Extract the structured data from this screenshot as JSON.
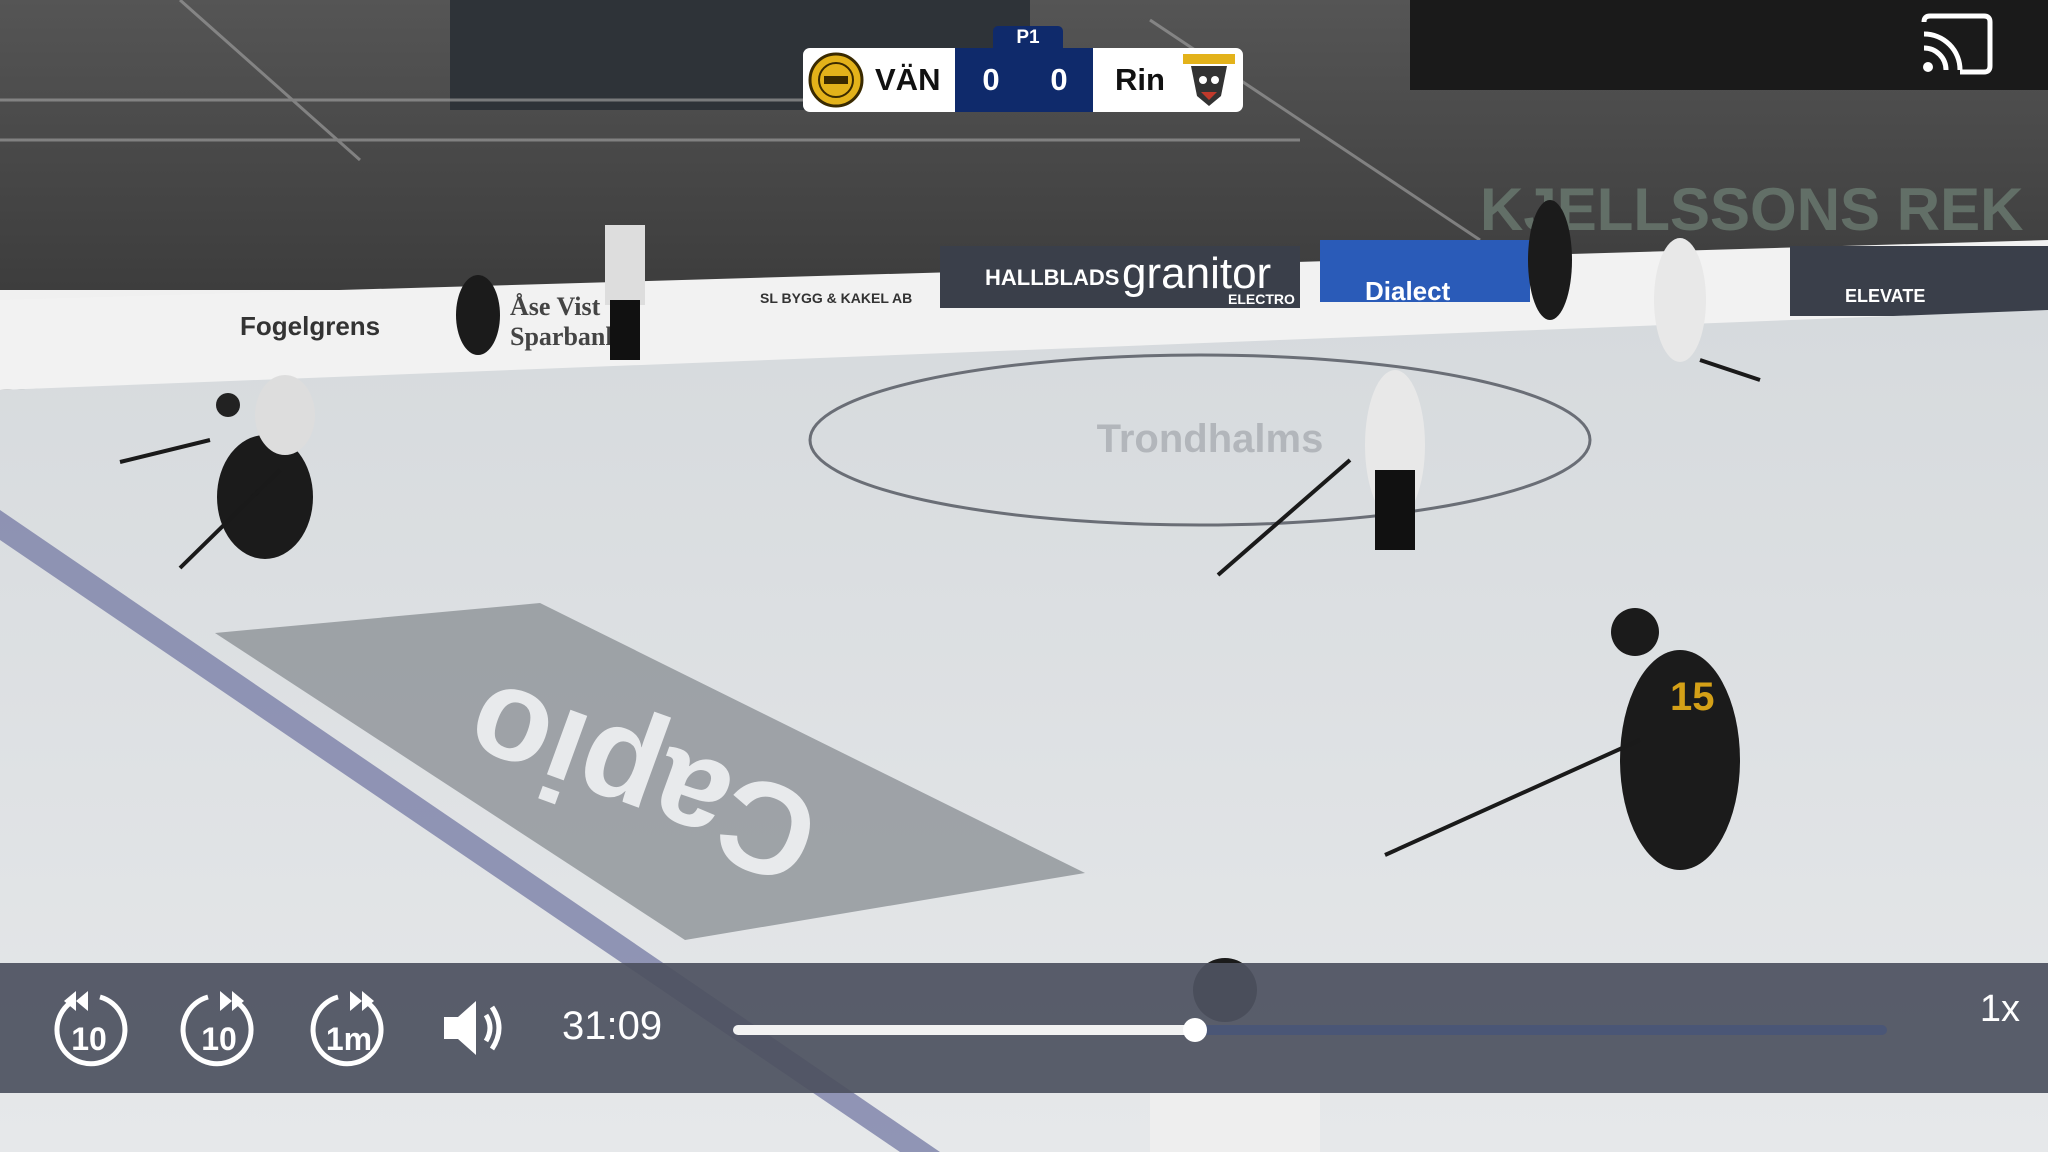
{
  "scoreboard": {
    "period": "P1",
    "home": {
      "abbr": "VÄN",
      "score": "0"
    },
    "away": {
      "abbr": "Rin",
      "score": "0"
    }
  },
  "arena": {
    "banners": [
      "Fogelgrens",
      "Åse Vist",
      "Sparbank",
      "SL BYGG & KAKEL AB",
      "HALLBLADS",
      "granitor",
      "ELECTRO",
      "Dialect",
      "ELEVATE",
      "KJELLSSONS REK"
    ],
    "ice_logo": "Capio"
  },
  "player": {
    "controls": {
      "rewind_10": {
        "label": "10",
        "icon": "rewind-10-icon"
      },
      "forward_10": {
        "label": "10",
        "icon": "forward-10-icon"
      },
      "forward_1m": {
        "label": "1m",
        "icon": "forward-1m-icon"
      },
      "volume": {
        "icon": "volume-icon"
      }
    },
    "current_time": "31:09",
    "progress": 0.4,
    "playback_rate": "1x",
    "cast_icon": "cast-icon"
  },
  "colors": {
    "score_bg": "#0f2a6b",
    "control_bar": "#4e5260",
    "progress_played": "#f2f2f2",
    "progress_remaining": "#4a5676"
  }
}
